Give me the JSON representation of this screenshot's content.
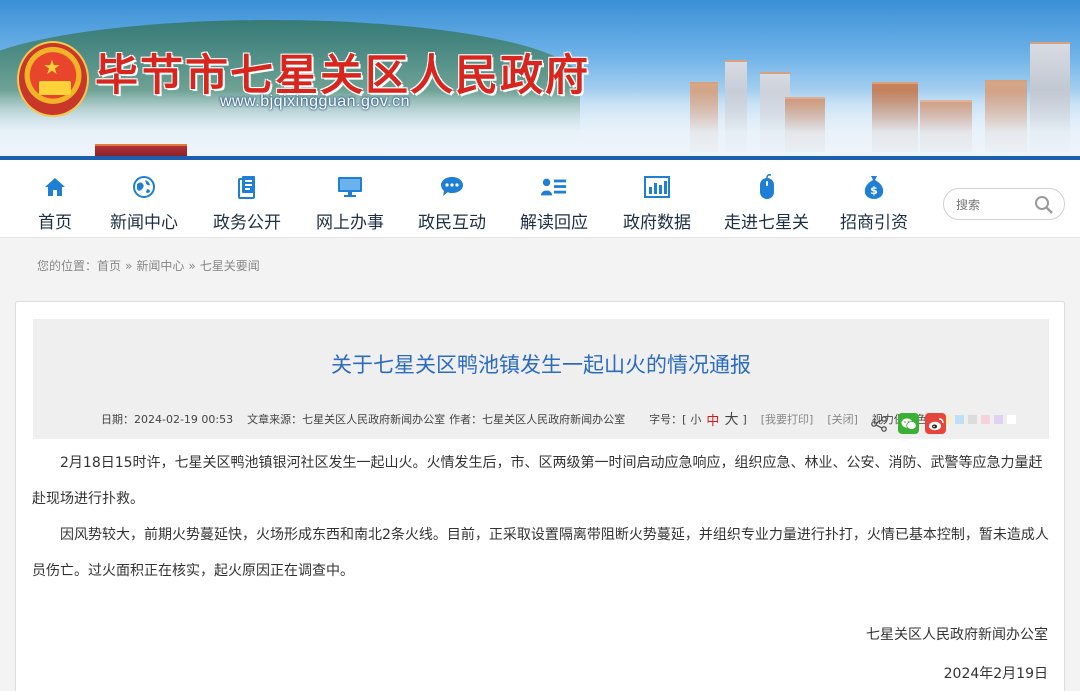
{
  "header": {
    "site_title": "毕节市七星关区人民政府",
    "site_url": "www.bjqixingguan.gov.cn"
  },
  "nav": {
    "items": [
      {
        "label": "首页",
        "icon": "home-icon"
      },
      {
        "label": "新闻中心",
        "icon": "globe-icon"
      },
      {
        "label": "政务公开",
        "icon": "document-icon"
      },
      {
        "label": "网上办事",
        "icon": "monitor-icon"
      },
      {
        "label": "政民互动",
        "icon": "chat-icon"
      },
      {
        "label": "解读回应",
        "icon": "user-list-icon"
      },
      {
        "label": "政府数据",
        "icon": "bar-chart-icon"
      },
      {
        "label": "走进七星关",
        "icon": "mouse-icon"
      },
      {
        "label": "招商引资",
        "icon": "money-bag-icon"
      }
    ],
    "search_placeholder": "搜索"
  },
  "breadcrumb": {
    "prefix": "您的位置：",
    "items": [
      "首页",
      "新闻中心",
      "七星关要闻"
    ],
    "separator": "»"
  },
  "article": {
    "title": "关于七星关区鸭池镇发生一起山火的情况通报",
    "meta": {
      "date": "日期：2024-02-19 00:53",
      "source": "文章来源：七星关区人民政府新闻办公室",
      "author": "作者：七星关区人民政府新闻办公室",
      "font_label": "字号：[",
      "font_small": "小",
      "font_medium": "中",
      "font_large": "大",
      "font_close": "]",
      "print": "[我要打印]",
      "close": "[关闭]",
      "eye_label": "视力保护色：",
      "eye_colors": [
        "#f7eec1",
        "#bfe0f4",
        "#dcdcdc",
        "#f6d3d9",
        "#e0d2f2",
        "#ffffff"
      ]
    },
    "paragraphs": [
      "2月18日15时许，七星关区鸭池镇银河社区发生一起山火。火情发生后，市、区两级第一时间启动应急响应，组织应急、林业、公安、消防、武警等应急力量赶赴现场进行扑救。",
      "因风势较大，前期火势蔓延快，火场形成东西和南北2条火线。目前，正采取设置隔离带阻断火势蔓延，并组织专业力量进行扑打，火情已基本控制，暂未造成人员伤亡。过火面积正在核实，起火原因正在调查中。"
    ],
    "signature": "七星关区人民政府新闻办公室",
    "sign_date": "2024年2月19日"
  },
  "colors": {
    "title_blue": "#2b6cc0",
    "nav_icon_blue": "#1f7fd4",
    "site_title_red": "#d8261f",
    "wechat_green": "#3cb034",
    "weibo_red": "#e6453b"
  }
}
